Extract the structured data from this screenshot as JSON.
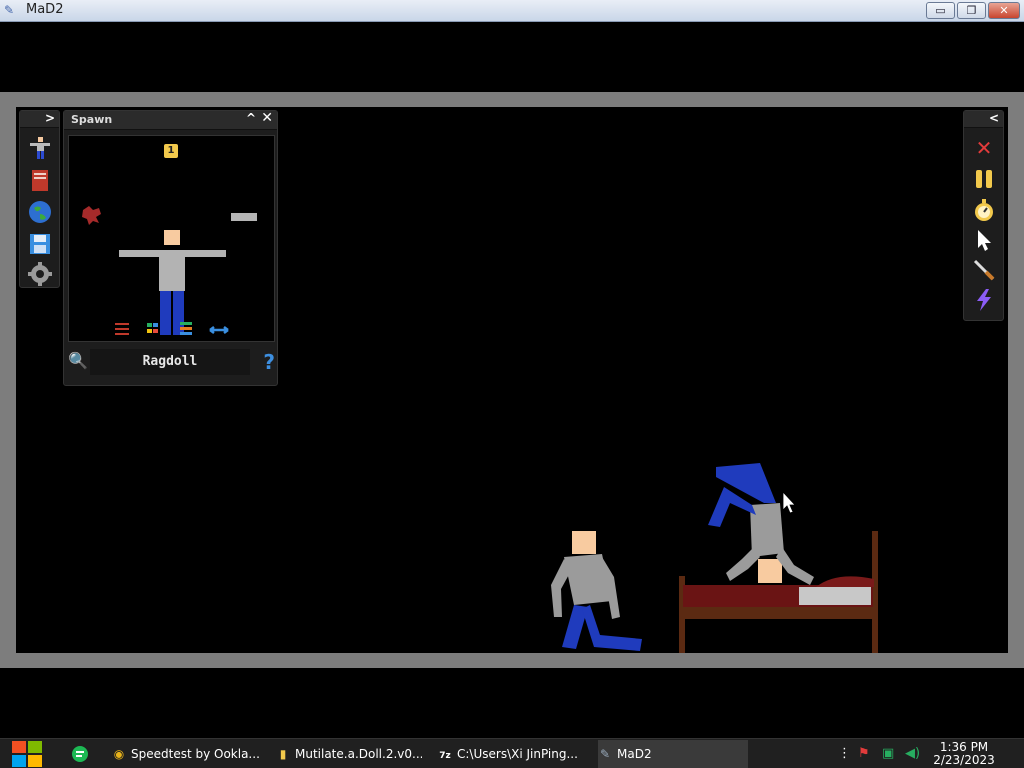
{
  "window": {
    "title": "MaD2",
    "minimize": "▭",
    "maximize": "❐",
    "close": "✕"
  },
  "left_strip": {
    "expand_glyph": ">",
    "tools": [
      {
        "icon": "ragdoll-tool-icon",
        "glyph": "🧍"
      },
      {
        "icon": "book-icon",
        "glyph": "📕"
      },
      {
        "icon": "globe-icon",
        "glyph": "🌍"
      },
      {
        "icon": "save-icon",
        "glyph": "💾"
      },
      {
        "icon": "gear-icon",
        "glyph": "⚙"
      }
    ]
  },
  "spawn_panel": {
    "title": "Spawn",
    "collapse_glyph": "^",
    "close_glyph": "✕",
    "count_badge": "1",
    "item_name": "Ragdoll",
    "search_glyph": "🔍",
    "help_glyph": "?"
  },
  "right_strip": {
    "collapse_glyph": "<",
    "tools": [
      {
        "icon": "delete-x-icon",
        "glyph": "✕",
        "color": "#e23b3b"
      },
      {
        "icon": "pause-icon",
        "glyph": "⏸",
        "color": "#f2c94c"
      },
      {
        "icon": "stopwatch-icon",
        "glyph": "⏱",
        "color": "#f2c94c"
      },
      {
        "icon": "cursor-icon",
        "glyph": "➤",
        "color": "#ffffff"
      },
      {
        "icon": "knife-icon",
        "glyph": "/",
        "color": "#e0a050"
      },
      {
        "icon": "lightning-icon",
        "glyph": "⚡",
        "color": "#8b5cf6"
      }
    ]
  },
  "taskbar": {
    "start_icon": "windows-icon",
    "items": [
      {
        "label": "Speedtest by Ookla...",
        "icon": "chrome-icon"
      },
      {
        "label": "Mutilate.a.Doll.2.v0...",
        "icon": "folder-icon"
      },
      {
        "label": "C:\\Users\\Xi JinPing...",
        "icon": "7zip-icon"
      },
      {
        "label": "MaD2",
        "icon": "mad2-icon"
      }
    ],
    "clock_time": "1:36 PM",
    "clock_date": "2/23/2023"
  }
}
